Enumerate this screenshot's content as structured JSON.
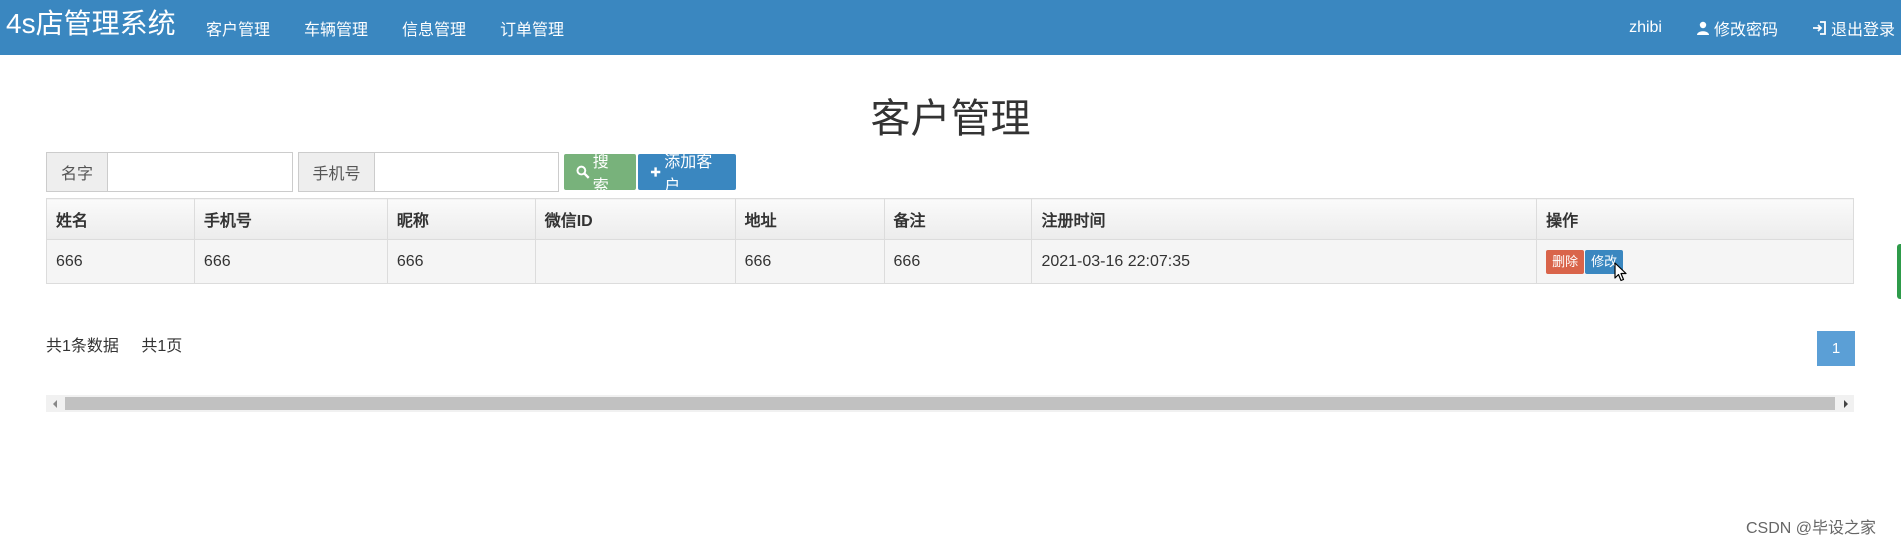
{
  "navbar": {
    "brand": "4s店管理系统",
    "menu": [
      "客户管理",
      "车辆管理",
      "信息管理",
      "订单管理"
    ],
    "user": "zhibi",
    "change_password": "修改密码",
    "logout": "退出登录",
    "background_color": "#3a87c0"
  },
  "page": {
    "title": "客户管理"
  },
  "search": {
    "name_label": "名字",
    "name_value": "",
    "phone_label": "手机号",
    "phone_value": "",
    "search_button": "搜索",
    "add_button": "添加客户",
    "search_icon": "search-icon",
    "add_icon": "plus-icon"
  },
  "table": {
    "columns": [
      "姓名",
      "手机号",
      "昵称",
      "微信ID",
      "地址",
      "备注",
      "注册时间",
      "操作"
    ],
    "rows": [
      {
        "name": "666",
        "phone": "666",
        "nickname": "666",
        "wechat_id": "",
        "address": "666",
        "remark": "666",
        "registered_at": "2021-03-16 22:07:35",
        "delete_label": "删除",
        "edit_label": "修改"
      }
    ]
  },
  "pagination": {
    "total_records": "共1条数据",
    "total_pages": "共1页",
    "current_page": "1"
  },
  "watermark": "CSDN @毕设之家",
  "colors": {
    "primary": "#3a87c0",
    "success": "#78b27b",
    "danger": "#d9644a",
    "page_active": "#5b9fd6"
  }
}
